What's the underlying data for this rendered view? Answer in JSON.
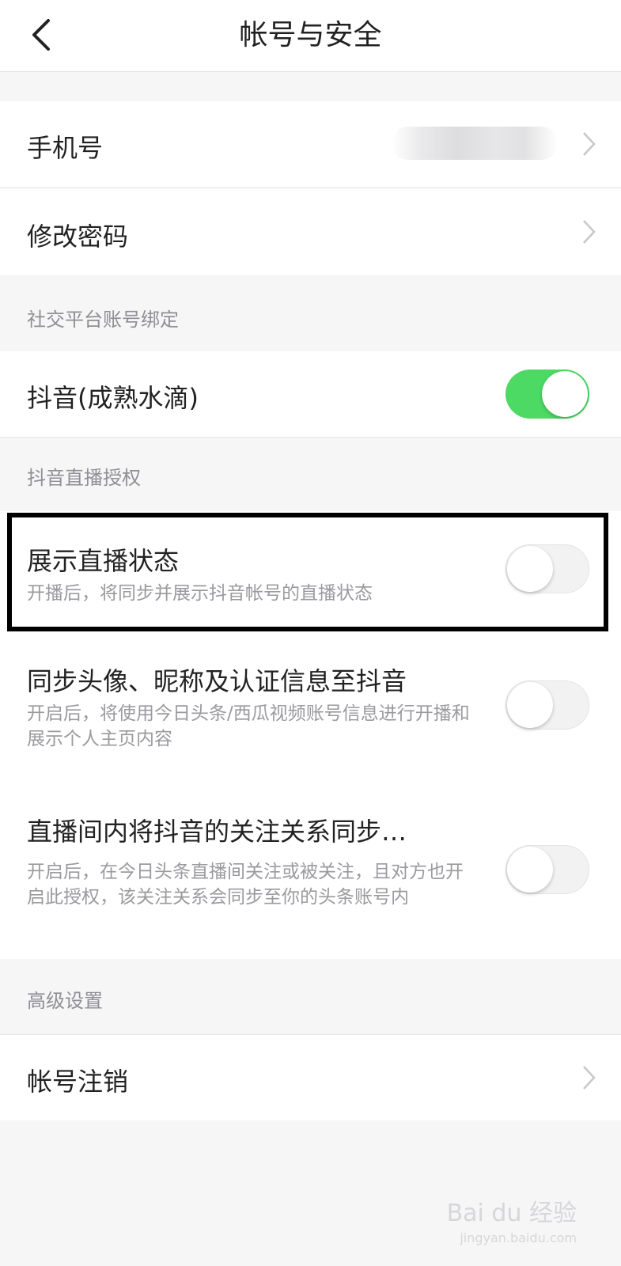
{
  "nav": {
    "title": "帐号与安全"
  },
  "account": {
    "phone_label": "手机号",
    "password_label": "修改密码"
  },
  "social": {
    "section_title": "社交平台账号绑定",
    "douyin_label": "抖音(成熟水滴)",
    "douyin_enabled": true
  },
  "live_auth": {
    "section_title": "抖音直播授权",
    "items": [
      {
        "title": "展示直播状态",
        "desc": "开播后，将同步并展示抖音帐号的直播状态",
        "enabled": false
      },
      {
        "title": "同步头像、昵称及认证信息至抖音",
        "desc": "开启后，将使用今日头条/西瓜视频账号信息进行开播和展示个人主页内容",
        "enabled": false
      },
      {
        "title": "直播间内将抖音的关注关系同步…",
        "desc": "开启后，在今日头条直播间关注或被关注，且对方也开启此授权，该关注关系会同步至你的头条账号内",
        "enabled": false
      }
    ]
  },
  "advanced": {
    "section_title": "高级设置",
    "deactivate_label": "帐号注销"
  },
  "watermark": {
    "text": "Bai du 经验",
    "sub": "jingyan.baidu.com"
  },
  "colors": {
    "toggle_on": "#4cd964",
    "background": "#f6f6f7"
  }
}
